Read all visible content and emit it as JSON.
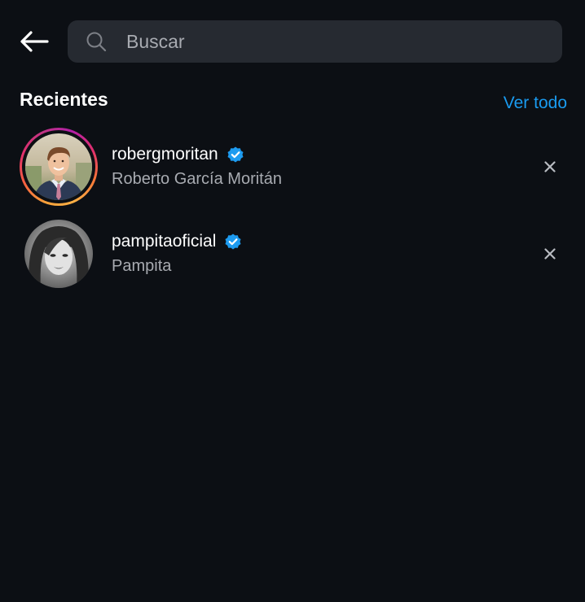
{
  "header": {
    "back_icon": "arrow-left-icon",
    "search": {
      "icon": "search-icon",
      "placeholder": "Buscar",
      "value": ""
    }
  },
  "recent": {
    "title": "Recientes",
    "see_all": "Ver todo",
    "items": [
      {
        "username": "robergmoritan",
        "full_name": "Roberto García Moritán",
        "verified": true,
        "has_story_ring": true,
        "remove_icon": "close-icon"
      },
      {
        "username": "pampitaoficial",
        "full_name": "Pampita",
        "verified": true,
        "has_story_ring": false,
        "remove_icon": "close-icon"
      }
    ]
  },
  "colors": {
    "background": "#0c0f14",
    "search_bg": "#262a31",
    "link": "#1a9bf0",
    "verified": "#1d9bf0",
    "secondary_text": "#a8abb1"
  }
}
